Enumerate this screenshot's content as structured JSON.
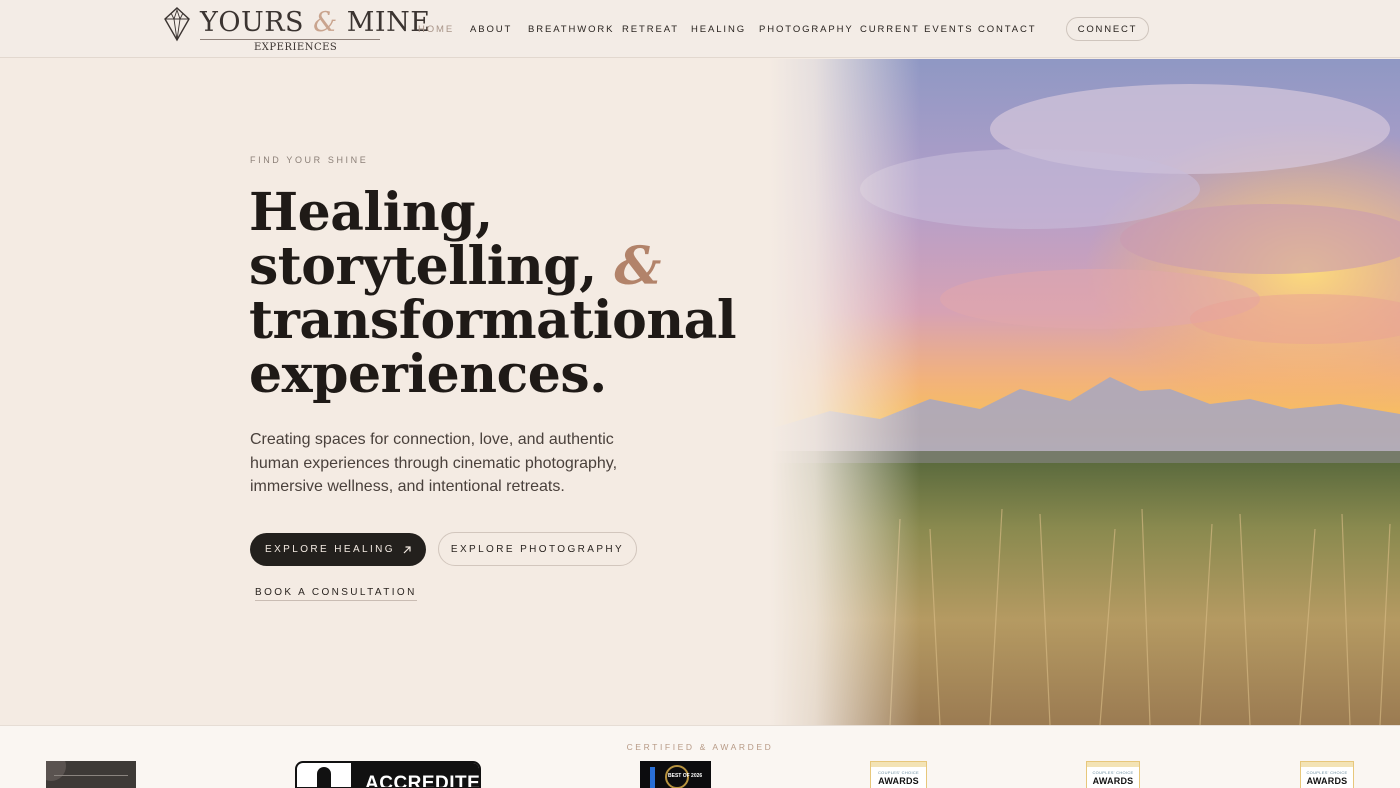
{
  "brand": {
    "name_part1": "YOURS",
    "ampersand": "&",
    "name_part2": "MINE",
    "subtitle": "EXPERIENCES"
  },
  "nav": {
    "items": [
      {
        "label": "HOME",
        "active": true
      },
      {
        "label": "ABOUT",
        "active": false
      },
      {
        "label": "BREATHWORK",
        "active": false
      },
      {
        "label": "RETREAT",
        "active": false
      },
      {
        "label": "HEALING",
        "active": false
      },
      {
        "label": "PHOTOGRAPHY",
        "active": false
      },
      {
        "label": "CURRENT EVENTS",
        "active": false
      },
      {
        "label": "CONTACT",
        "active": false
      }
    ],
    "cta_label": "CONNECT"
  },
  "hero": {
    "eyebrow": "FIND YOUR SHINE",
    "headline_line1": "Healing,",
    "headline_line2": "storytelling,",
    "headline_amp": "&",
    "headline_line3": "transformational",
    "headline_line4": "experiences.",
    "lede": "Creating spaces for connection, love, and authentic human experiences through cinematic photography, immersive wellness, and intentional retreats.",
    "primary_button": "EXPLORE HEALING",
    "primary_button_icon": "arrow-up-right-icon",
    "secondary_button": "EXPLORE PHOTOGRAPHY",
    "tertiary_link": "BOOK A CONSULTATION",
    "image_alt": "sunset-over-mountains-and-grassy-meadow"
  },
  "awards": {
    "label": "CERTIFIED & AWARDED",
    "badge2_text": "ACCREDITED",
    "badge3_text": "BEST OF 2026",
    "badge_small": "COUPLES' CHOICE",
    "badge_big": "AWARDS"
  },
  "colors": {
    "background": "#f4ebe3",
    "text_dark": "#1f1a17",
    "accent": "#b2836a",
    "button_dark": "#23201d"
  }
}
